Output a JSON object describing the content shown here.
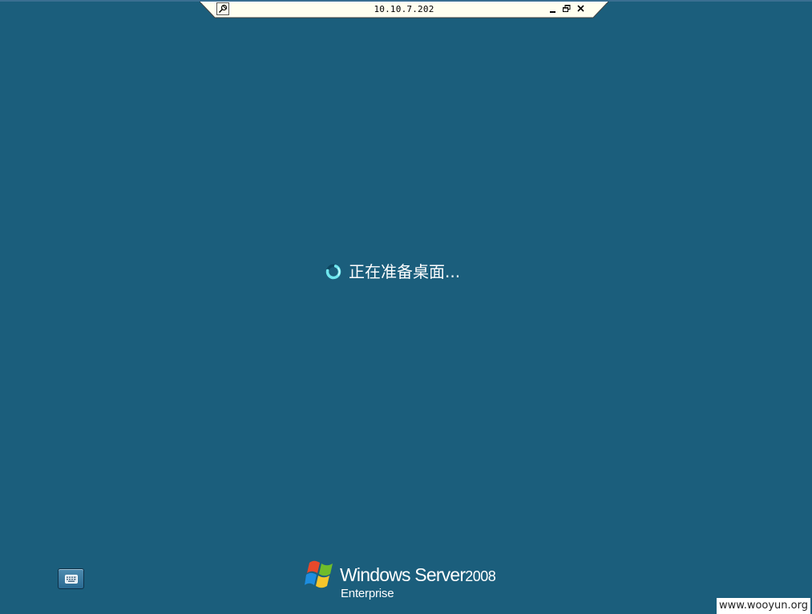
{
  "connection_bar": {
    "host": "10.10.7.202",
    "pin_icon": "pushpin-icon",
    "minimize_icon": "minimize-icon",
    "restore_icon": "restore-icon",
    "close_icon": "close-icon"
  },
  "status": {
    "spinner_icon": "loading-spinner-icon",
    "text": "正在准备桌面..."
  },
  "ease_of_access": {
    "icon": "keyboard-icon"
  },
  "branding": {
    "logo_icon": "windows-flag-icon",
    "product": "Windows Server",
    "version": "2008",
    "edition": "Enterprise"
  },
  "watermark": "www.wooyun.org",
  "colors": {
    "desktop_background": "#1b5e7c",
    "bar_background": "#fffff0",
    "spinner_accent": "#5fe0e8"
  }
}
